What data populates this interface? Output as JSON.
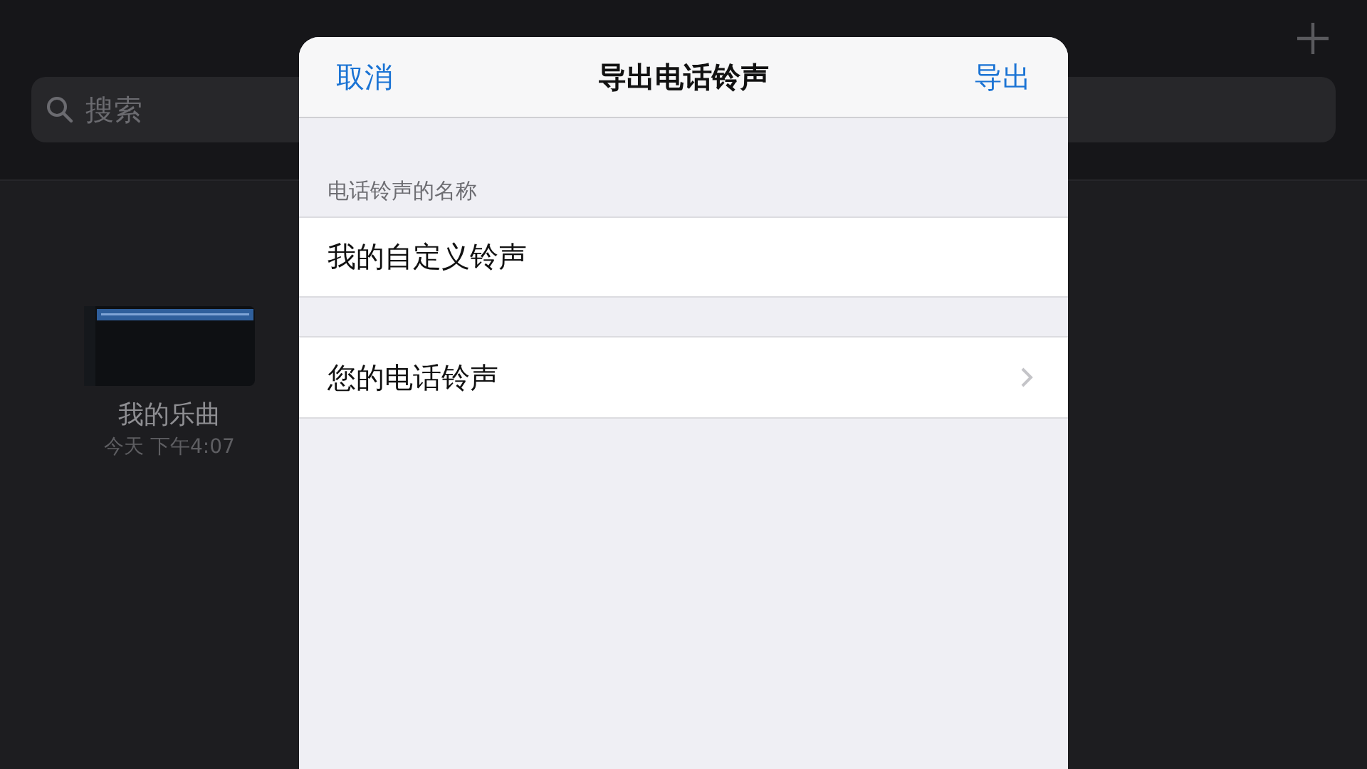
{
  "background": {
    "search": {
      "placeholder": "搜索"
    },
    "projects": [
      {
        "name": "我的乐曲",
        "date": "今天 下午4:07"
      }
    ]
  },
  "sheet": {
    "title": "导出电话铃声",
    "cancel": "取消",
    "export": "导出",
    "section_label": "电话铃声的名称",
    "name_field": {
      "value": "我的自定义铃声"
    },
    "rows": [
      {
        "label": "您的电话铃声",
        "kind": "link"
      }
    ]
  }
}
